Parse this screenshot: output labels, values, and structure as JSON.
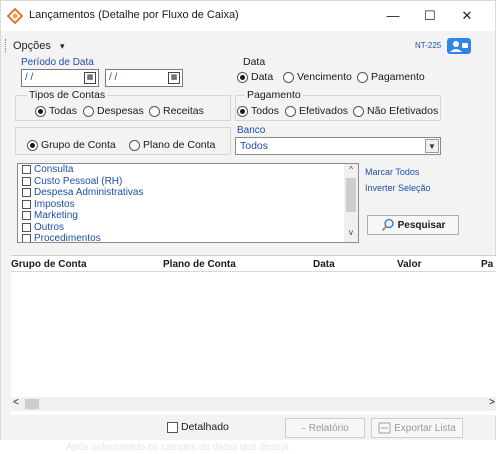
{
  "window": {
    "title": "Lançamentos (Detalhe por Fluxo de Caixa)"
  },
  "window_controls": {
    "minimize": "—",
    "maximize": "☐",
    "close": "✕"
  },
  "menubar": {
    "opcoes_label": "Opções",
    "opcoes_arrow": "▾",
    "nt_label": "NT-225"
  },
  "periodo": {
    "label": "Período de Data",
    "start": "/ /",
    "end": "/ /"
  },
  "data_group": {
    "title": "Data",
    "options": [
      "Data",
      "Vencimento",
      "Pagamento"
    ],
    "selected": "Data"
  },
  "tipos_group": {
    "title": "Tipos de Contas",
    "options": [
      "Todas",
      "Despesas",
      "Receitas"
    ],
    "selected": "Todas"
  },
  "pagamento_group": {
    "title": "Pagamento",
    "options": [
      "Todos",
      "Efetivados",
      "Não Efetivados"
    ],
    "selected": "Todos"
  },
  "conta_group": {
    "options": [
      "Grupo de Conta",
      "Plano de Conta"
    ],
    "selected": "Grupo de Conta"
  },
  "banco": {
    "label": "Banco",
    "selected": "Todos"
  },
  "list": {
    "items": [
      "Consulta",
      "Custo Pessoal (RH)",
      "Despesa Administrativas",
      "Impostos",
      "Marketing",
      "Outros",
      "Procedimentos"
    ]
  },
  "links": {
    "marcar_todos": "Marcar Todos",
    "inverter": "Inverter Seleção"
  },
  "buttons": {
    "pesquisar": "Pesquisar",
    "relatorio": "Relatório",
    "exportar": "Exportar Lista"
  },
  "grid": {
    "columns": [
      "Grupo de Conta",
      "Plano de Conta",
      "Data",
      "Valor",
      "Pa"
    ]
  },
  "scroll": {
    "left": "<",
    "right": ">",
    "up": "^",
    "down": "v"
  },
  "footer": {
    "detalhado_label": "Detalhado",
    "faded_text": "Após selecionado os campos de datas que deseja"
  },
  "colors": {
    "accent_blue": "#1d4ea8",
    "user_button": "#2f86e8"
  }
}
